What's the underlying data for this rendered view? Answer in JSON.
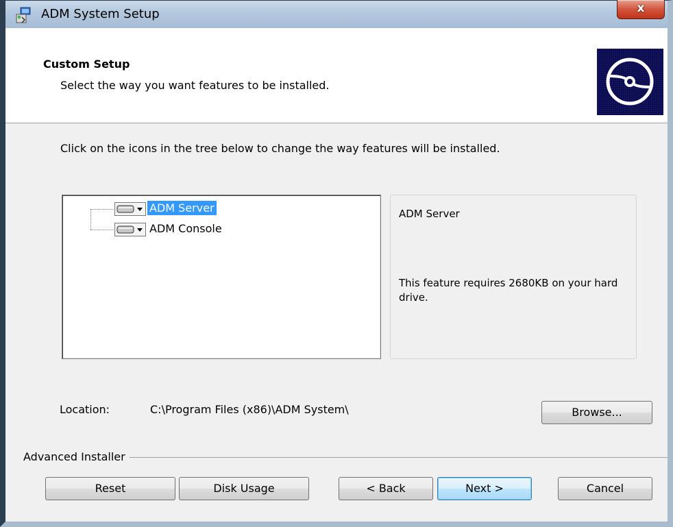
{
  "window": {
    "title": "ADM System Setup",
    "close_label": "x"
  },
  "banner": {
    "title": "Custom Setup",
    "subtitle": "Select the way you want features to be installed.",
    "image_icon": "disc-icon"
  },
  "instruction": "Click on the icons in the tree below to change the way features will be installed.",
  "tree": {
    "items": [
      {
        "label": "ADM Server",
        "icon": "drive-icon",
        "selected": true
      },
      {
        "label": "ADM Console",
        "icon": "drive-icon",
        "selected": false
      }
    ]
  },
  "description": {
    "title": "ADM Server",
    "body": "This feature requires 2680KB on your hard drive."
  },
  "location": {
    "label": "Location:",
    "value": "C:\\Program Files (x86)\\ADM System\\"
  },
  "buttons": {
    "browse": "Browse...",
    "reset": "Reset",
    "disk_usage": "Disk Usage",
    "back": "< Back",
    "next": "Next >",
    "cancel": "Cancel"
  },
  "footer": {
    "group_label": "Advanced Installer"
  },
  "colors": {
    "selection": "#3399ff",
    "banner_bg": "#ffffff",
    "dialog_bg": "#f0f0f0",
    "close_red": "#c0331b"
  }
}
